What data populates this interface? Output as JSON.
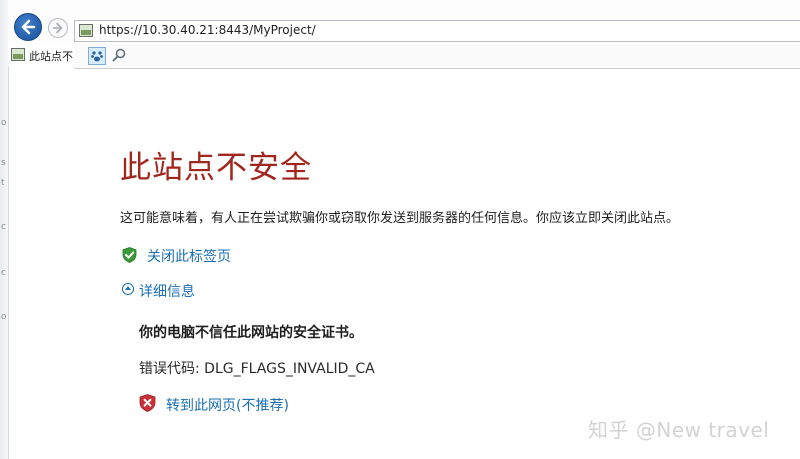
{
  "browser": {
    "url": "https://10.30.40.21:8443/MyProject/",
    "tab_title": "此站点不"
  },
  "page": {
    "headline": "此站点不安全",
    "message": "这可能意味着，有人正在尝试欺骗你或窃取你发送到服务器的任何信息。你应该立即关闭此站点。",
    "close_tab_link": "关闭此标签页",
    "details_link": "详细信息",
    "cert_untrusted": "你的电脑不信任此网站的安全证书。",
    "error_code": "错误代码: DLG_FLAGS_INVALID_CA",
    "continue_link": "转到此网页(不推荐)"
  },
  "watermark": "知乎 @New travel",
  "colors": {
    "headline": "#a1261e",
    "link": "#1a6fb4"
  },
  "icons": {
    "back": "back-arrow-icon",
    "forward": "forward-arrow-icon",
    "site": "site-favicon-icon",
    "compat": "compat-view-icon",
    "search": "search-icon",
    "safe_shield": "green-shield-check-icon",
    "warning_shield": "red-shield-x-icon",
    "collapse": "collapse-chevron-icon"
  }
}
